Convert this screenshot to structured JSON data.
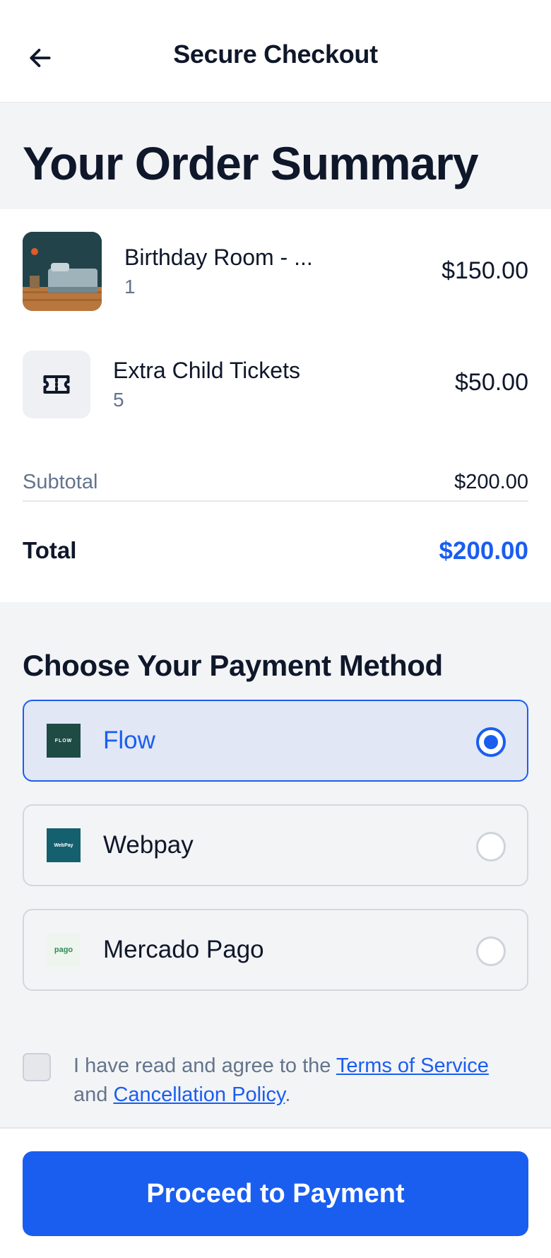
{
  "header": {
    "title": "Secure Checkout",
    "back_icon": "arrow-left-icon"
  },
  "summary": {
    "title": "Your Order Summary",
    "items": [
      {
        "name": "Birthday Room - ...",
        "quantity": "1",
        "price": "$150.00",
        "thumbnail": "bedroom-photo"
      },
      {
        "name": "Extra Child Tickets",
        "quantity": "5",
        "price": "$50.00",
        "thumbnail": "ticket-icon"
      }
    ],
    "subtotal_label": "Subtotal",
    "subtotal_value": "$200.00",
    "total_label": "Total",
    "total_value": "$200.00"
  },
  "payment": {
    "title": "Choose Your Payment Method",
    "options": [
      {
        "label": "Flow",
        "logo_text": "FLOW",
        "logo_color": "#1f4b45",
        "selected": true
      },
      {
        "label": "Webpay",
        "logo_text": "WebPay",
        "logo_color": "#14606e",
        "selected": false
      },
      {
        "label": "Mercado Pago",
        "logo_text": "pago",
        "logo_color": "#2e8b57",
        "selected": false
      }
    ]
  },
  "terms": {
    "prefix": "I have read and agree to the ",
    "tos_link": "Terms of Service",
    "middle": " and ",
    "policy_link": "Cancellation Policy",
    "suffix": ".",
    "checked": false
  },
  "footer": {
    "proceed_label": "Proceed to Payment"
  },
  "colors": {
    "accent": "#1a5ef0",
    "selected_bg": "#e1e7f5",
    "muted_text": "#64748b"
  }
}
